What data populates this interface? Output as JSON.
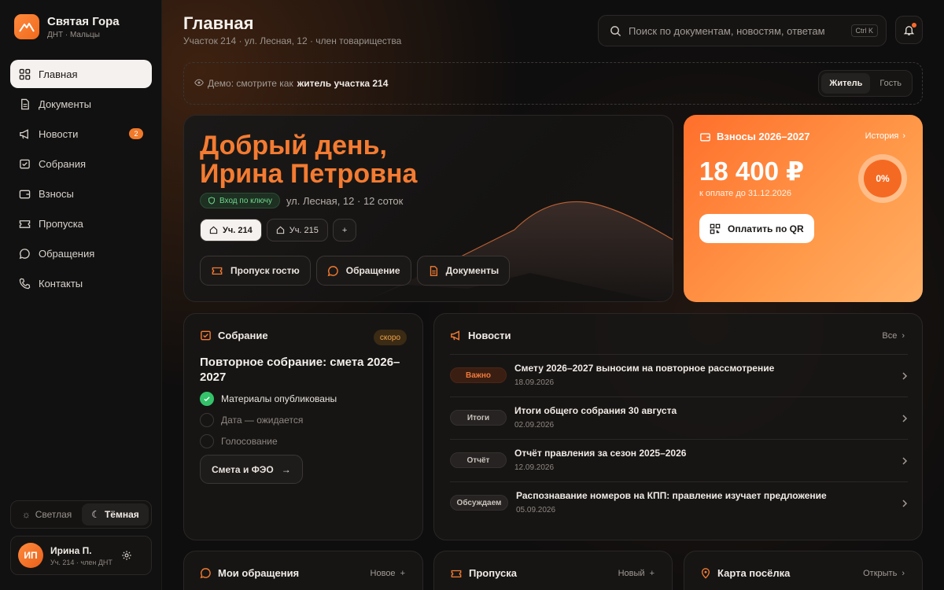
{
  "brand": {
    "name": "Святая Гора",
    "sub": "ДНТ · Мальцы"
  },
  "nav": {
    "items": [
      {
        "label": "Главная",
        "icon": "grid-icon",
        "active": true
      },
      {
        "label": "Документы",
        "icon": "document-icon"
      },
      {
        "label": "Новости",
        "icon": "megaphone-icon",
        "badge": "2"
      },
      {
        "label": "Собрания",
        "icon": "ballot-icon"
      },
      {
        "label": "Взносы",
        "icon": "wallet-icon"
      },
      {
        "label": "Пропуска",
        "icon": "ticket-icon"
      },
      {
        "label": "Обращения",
        "icon": "chat-icon"
      },
      {
        "label": "Контакты",
        "icon": "phone-icon"
      }
    ]
  },
  "theme": {
    "light": "Светлая",
    "dark": "Тёмная",
    "selected": "Тёмная"
  },
  "user": {
    "initials": "ИП",
    "name": "Ирина П.",
    "sub": "Уч. 214 · член ДНТ"
  },
  "header": {
    "title": "Главная",
    "subtitle": "Участок 214 · ул. Лесная, 12 · член товарищества",
    "search_placeholder": "Поиск по документам, новостям, ответам",
    "search_shortcut": "Ctrl K"
  },
  "demo": {
    "prefix": "Демо: смотрите как",
    "role": "житель участка 214",
    "roles": [
      "Житель",
      "Гость"
    ],
    "selected_role": "Житель"
  },
  "hero": {
    "greeting_line1": "Добрый день,",
    "greeting_line2": "Ирина Петровна",
    "key_badge": "Вход по ключу",
    "address": "ул. Лесная, 12 · 12 соток",
    "plots": [
      "Уч. 214",
      "Уч. 215"
    ],
    "add_plot": "+",
    "actions": [
      "Пропуск гостю",
      "Обращение",
      "Документы"
    ]
  },
  "fees": {
    "title": "Взносы 2026–2027",
    "history": "История",
    "amount": "18 400 ₽",
    "due": "к оплате до 31.12.2026",
    "progress_label": "0%",
    "progress": 0,
    "pay_button": "Оплатить по QR"
  },
  "meeting": {
    "title": "Собрание",
    "badge": "скоро",
    "headline": "Повторное собрание: смета 2026–2027",
    "steps": [
      {
        "label": "Материалы опубликованы",
        "done": true
      },
      {
        "label": "Дата — ожидается",
        "done": false
      },
      {
        "label": "Голосование",
        "done": false
      }
    ],
    "button": "Смета и ФЭО"
  },
  "news": {
    "title": "Новости",
    "all": "Все",
    "items": [
      {
        "tag": "Важно",
        "title": "Смету 2026–2027 выносим на повторное рассмотрение",
        "date": "18.09.2026"
      },
      {
        "tag": "Итоги",
        "title": "Итоги общего собрания 30 августа",
        "date": "02.09.2026"
      },
      {
        "tag": "Отчёт",
        "title": "Отчёт правления за сезон 2025–2026",
        "date": "12.09.2026"
      },
      {
        "tag": "Обсуждаем",
        "title": "Распознавание номеров на КПП: правление изучает предложение",
        "date": "05.09.2026"
      }
    ]
  },
  "appeals": {
    "title": "Мои обращения",
    "link": "Новое"
  },
  "passes": {
    "title": "Пропуска",
    "link": "Новый"
  },
  "map": {
    "title": "Карта посёлка",
    "link": "Открыть"
  },
  "colors": {
    "accent": "#f47b31",
    "success": "#34c26a",
    "background": "#0f0e0e"
  }
}
